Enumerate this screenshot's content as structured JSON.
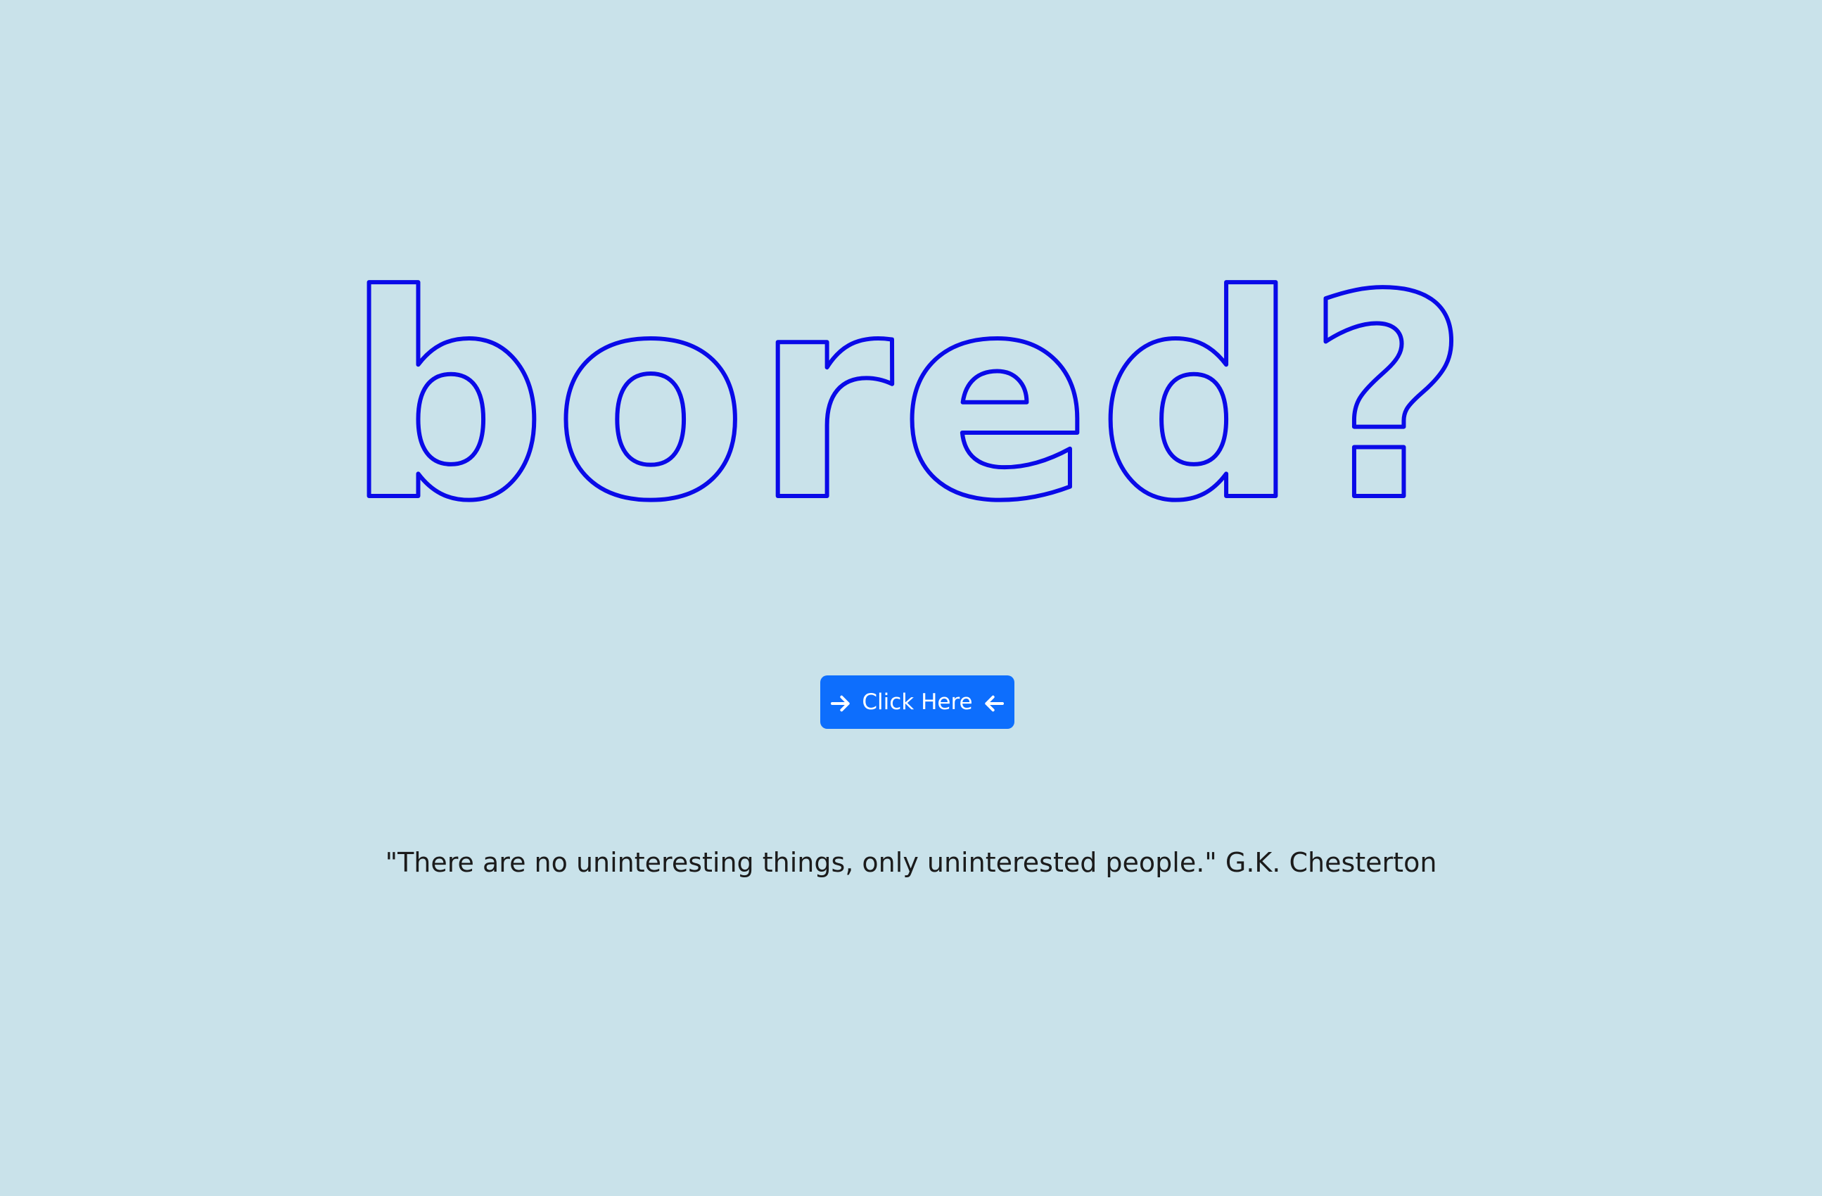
{
  "hero": {
    "headline": "bored?"
  },
  "cta": {
    "label": "Click Here",
    "left_icon": "arrow-right-icon",
    "right_icon": "arrow-left-icon"
  },
  "quote": {
    "text": "\"There are no uninteresting things, only uninterested people.\" G.K. Chesterton"
  },
  "colors": {
    "background": "#c9e2ea",
    "headline_outline": "#0a0ae8",
    "button": "#0d6efd",
    "button_text": "#ffffff",
    "quote_text": "#1b1b1b"
  }
}
